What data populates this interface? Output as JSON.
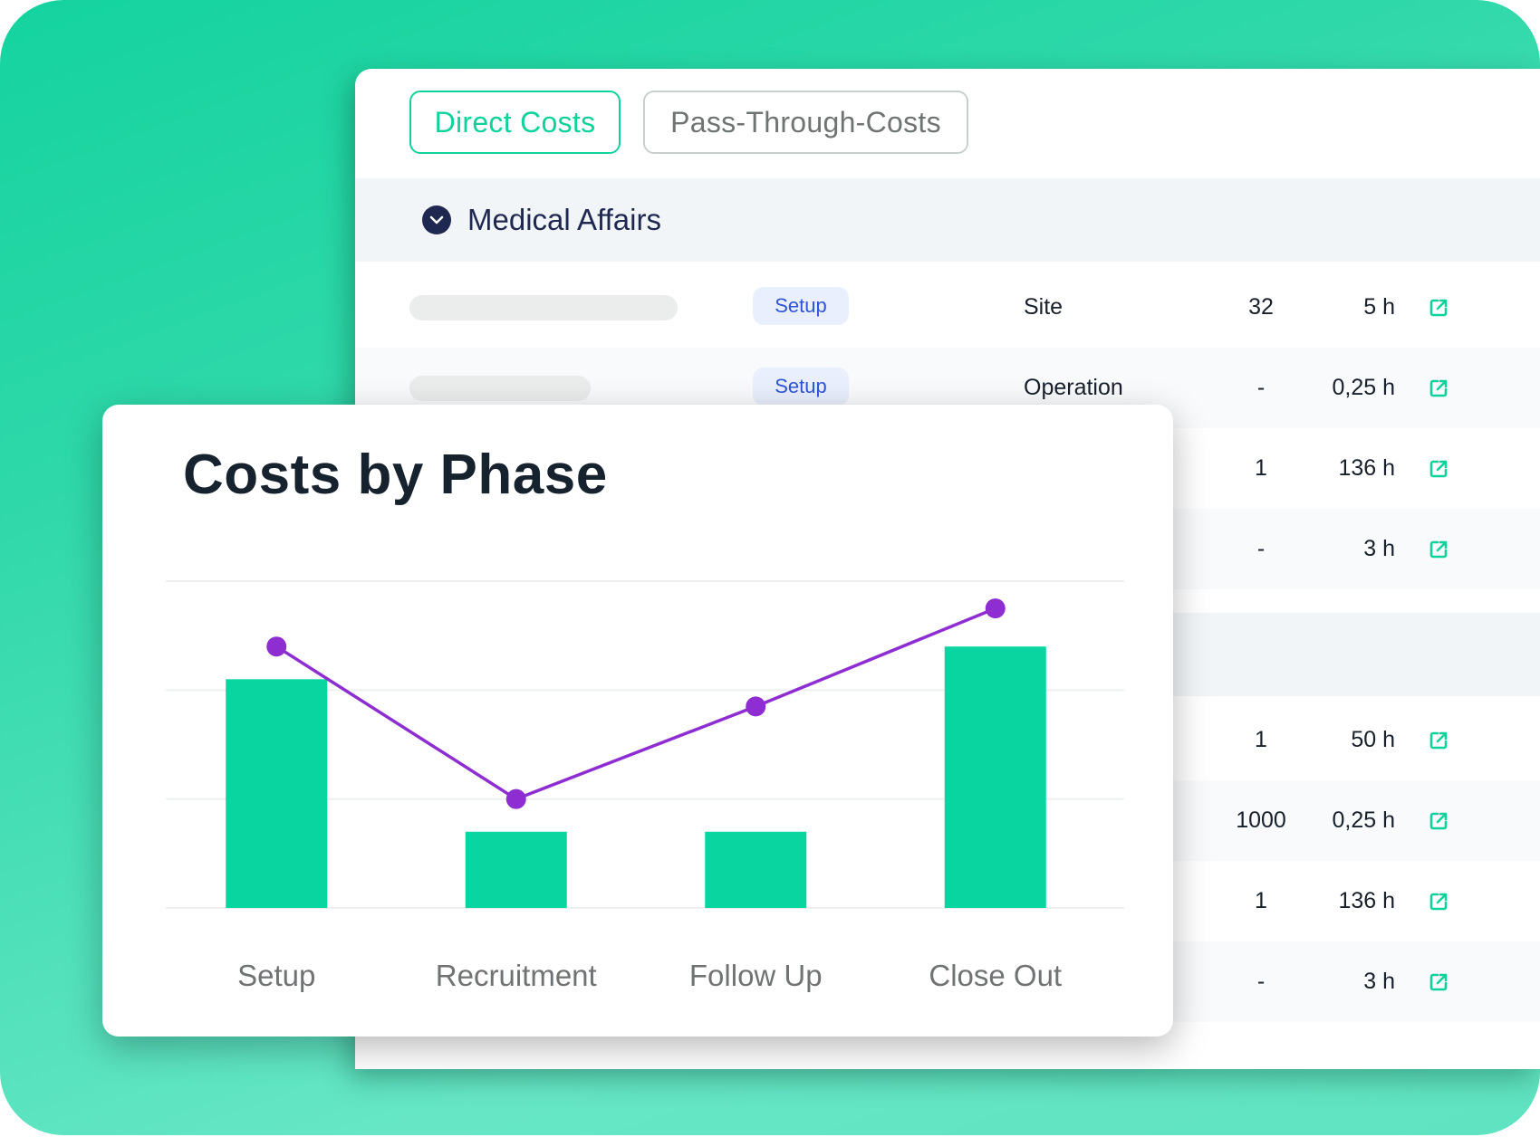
{
  "colors": {
    "accent": "#0cd39c",
    "bar": "#08d59f",
    "line": "#8e2dd1",
    "badge_text": "#2e55d6",
    "badge_bg": "#e9effc",
    "heading": "#1f2850"
  },
  "tabs": [
    {
      "label": "Direct Costs",
      "active": true
    },
    {
      "label": "Pass-Through-Costs",
      "active": false
    }
  ],
  "section": {
    "title": "Medical Affairs",
    "icon": "chevron-down-circle-icon"
  },
  "rows_group1": [
    {
      "badge": "Setup",
      "type": "Site",
      "qty": "32",
      "hours": "5 h",
      "icon": "external-link-icon"
    },
    {
      "badge": "Setup",
      "type": "Operation",
      "qty": "-",
      "hours": "0,25 h",
      "icon": "external-link-icon"
    },
    {
      "badge": "",
      "type": "",
      "qty": "1",
      "hours": "136 h",
      "icon": "external-link-icon"
    },
    {
      "badge": "",
      "type": "",
      "qty": "-",
      "hours": "3 h",
      "icon": "external-link-icon"
    }
  ],
  "rows_group2": [
    {
      "qty": "1",
      "hours": "50 h",
      "icon": "external-link-icon"
    },
    {
      "qty": "1000",
      "hours": "0,25 h",
      "icon": "external-link-icon"
    },
    {
      "qty": "1",
      "hours": "136 h",
      "icon": "external-link-icon"
    },
    {
      "qty": "-",
      "hours": "3 h",
      "icon": "external-link-icon"
    }
  ],
  "chart_data": {
    "type": "bar",
    "title": "Costs by Phase",
    "categories": [
      "Setup",
      "Recruitment",
      "Follow Up",
      "Close Out"
    ],
    "series": [
      {
        "name": "bars",
        "type": "bar",
        "values": [
          2.1,
          0.7,
          0.7,
          2.4
        ]
      },
      {
        "name": "line",
        "type": "line",
        "values": [
          2.4,
          1.0,
          1.85,
          2.75
        ]
      }
    ],
    "ylim": [
      0,
      3
    ],
    "grid": true,
    "xlabel": "",
    "ylabel": "",
    "legend": "none"
  }
}
